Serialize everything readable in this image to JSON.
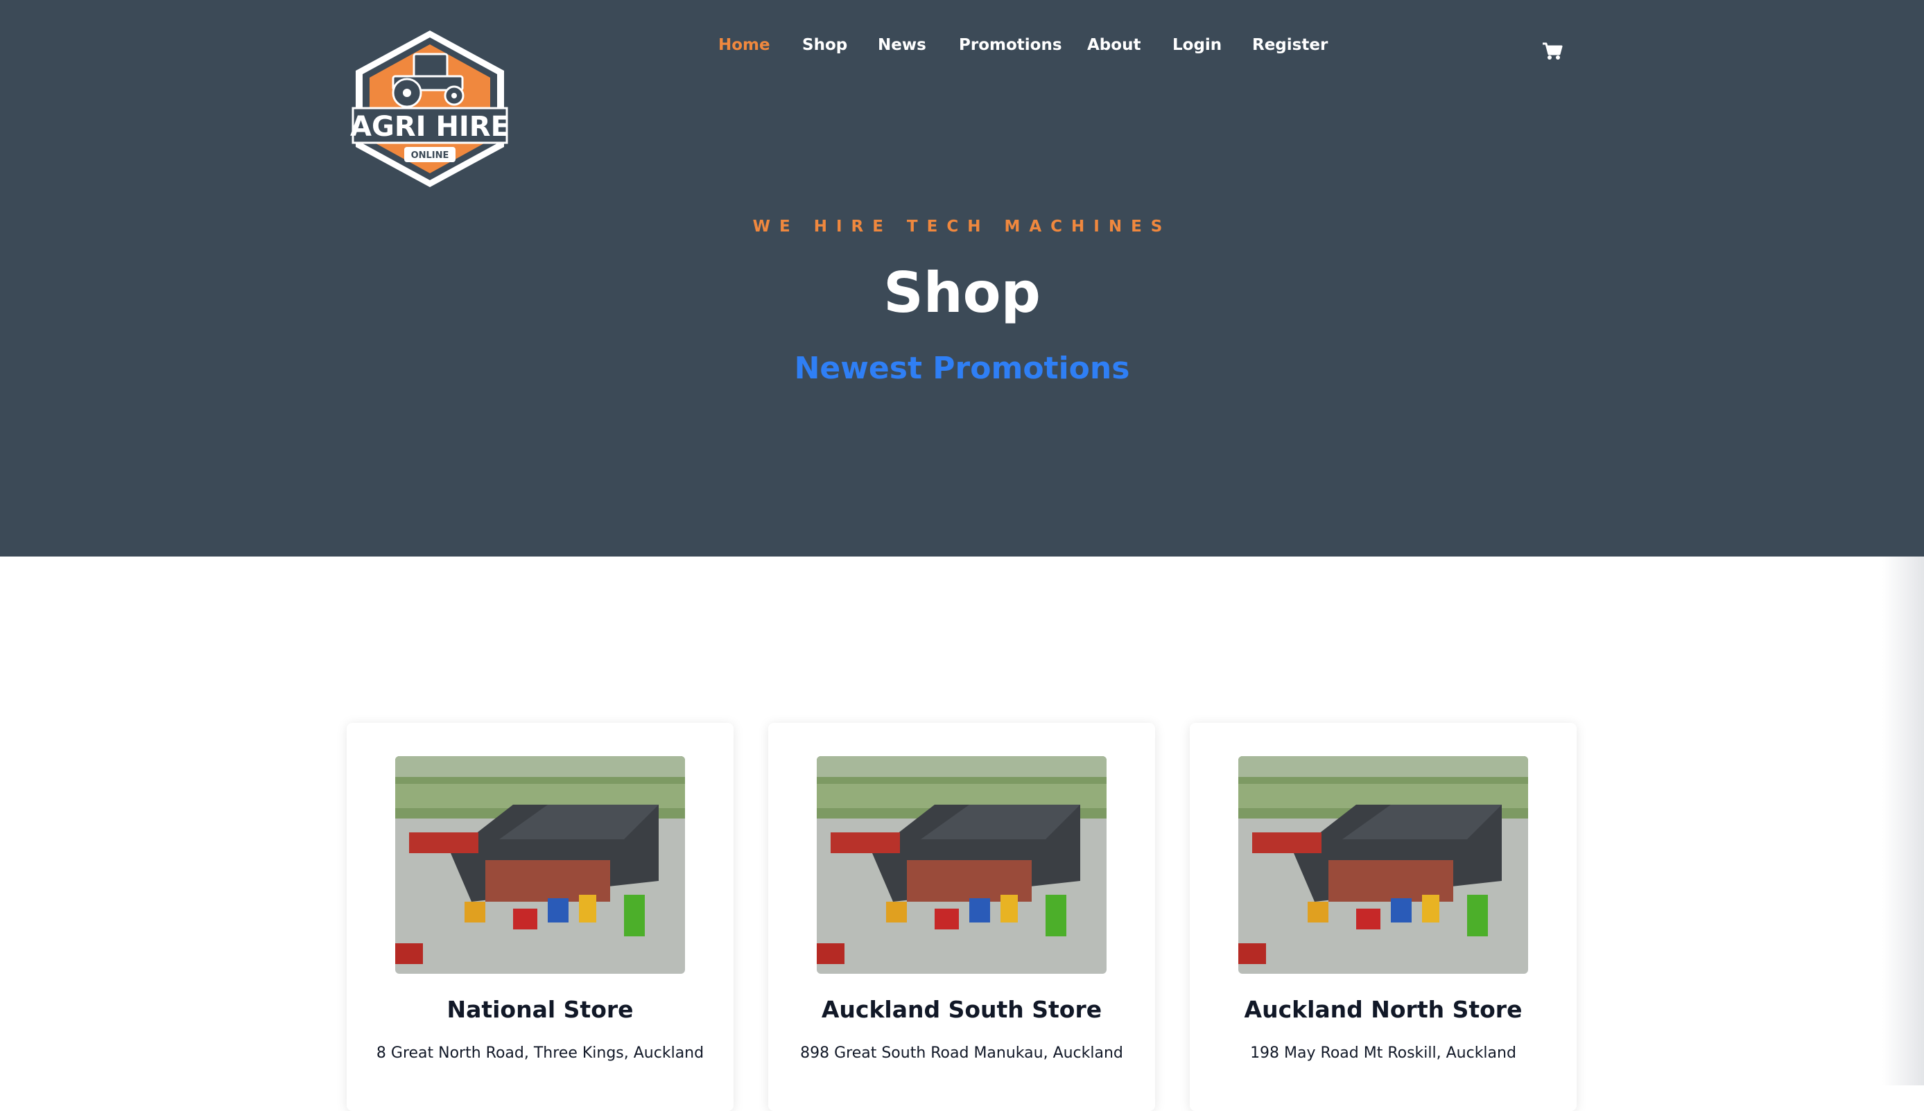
{
  "brand": {
    "logo_text": "AGRI HIRE",
    "logo_subtext": "ONLINE",
    "colors": {
      "hero_bg": "#3c4a57",
      "accent": "#f0883e",
      "link": "#2f7ff5"
    }
  },
  "nav": {
    "items": [
      {
        "label": "Home",
        "active": true
      },
      {
        "label": "Shop",
        "active": false
      },
      {
        "label": "News",
        "active": false
      },
      {
        "label": "Promotions",
        "active": false
      },
      {
        "label": "About",
        "active": false
      },
      {
        "label": "Login",
        "active": false
      },
      {
        "label": "Register",
        "active": false
      }
    ],
    "cart_icon": "shopping-cart-icon"
  },
  "hero": {
    "tagline": "WE HIRE TECH MACHINES",
    "title": "Shop",
    "subtitle": "Newest Promotions"
  },
  "stores": [
    {
      "name": "National Store",
      "address": "8 Great North Road, Three Kings, Auckland"
    },
    {
      "name": "Auckland South Store",
      "address": "898 Great South Road Manukau, Auckland"
    },
    {
      "name": "Auckland North Store",
      "address": "198 May Road Mt Roskill, Auckland"
    }
  ]
}
